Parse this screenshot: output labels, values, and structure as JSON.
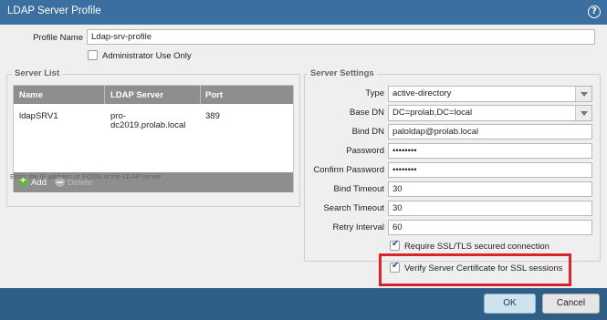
{
  "dialog": {
    "title": "LDAP Server Profile",
    "help_icon": "help-circle-icon"
  },
  "profile": {
    "name_label": "Profile Name",
    "name_value": "Ldap-srv-profile",
    "admin_use_label": "Administrator Use Only",
    "admin_use_checked": false
  },
  "server_list": {
    "legend": "Server List",
    "columns": [
      "Name",
      "LDAP Server",
      "Port"
    ],
    "rows": [
      {
        "name": "ldapSRV1",
        "server_line1": "pro-",
        "server_line2": "dc2019.prolab.local",
        "port": "389"
      }
    ],
    "add_label": "Add",
    "delete_label": "Delete",
    "hint": "Enter the IP address or FQDN of the LDAP server"
  },
  "server_settings": {
    "legend": "Server Settings",
    "type_label": "Type",
    "type_value": "active-directory",
    "base_dn_label": "Base DN",
    "base_dn_value": "DC=prolab,DC=local",
    "bind_dn_label": "Bind DN",
    "bind_dn_value": "paloldap@prolab.local",
    "password_label": "Password",
    "password_value": "••••••••",
    "confirm_password_label": "Confirm Password",
    "confirm_password_value": "••••••••",
    "bind_timeout_label": "Bind Timeout",
    "bind_timeout_value": "30",
    "search_timeout_label": "Search Timeout",
    "search_timeout_value": "30",
    "retry_interval_label": "Retry Interval",
    "retry_interval_value": "60",
    "require_ssl_label": "Require SSL/TLS secured connection",
    "require_ssl_checked": true,
    "verify_cert_label": "Verify Server Certificate for SSL sessions",
    "verify_cert_checked": true
  },
  "buttons": {
    "ok_label": "OK",
    "cancel_label": "Cancel"
  },
  "colors": {
    "titlebar": "#3a6f9f",
    "footer": "#2f5f87",
    "highlight": "#d8242d"
  }
}
